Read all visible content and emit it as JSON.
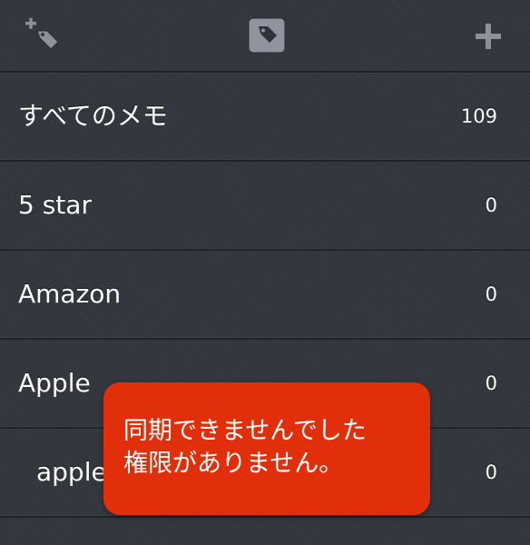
{
  "toolbar": {
    "left_icon": "add-tag-icon",
    "center_icon": "tag-icon",
    "right_icon": "plus-icon"
  },
  "tags": [
    {
      "label": "すべてのメモ",
      "count": "109"
    },
    {
      "label": "5 star",
      "count": "0"
    },
    {
      "label": "Amazon",
      "count": "0"
    },
    {
      "label": "Apple",
      "count": "0"
    },
    {
      "label": "apple",
      "count": "0"
    }
  ],
  "toast": {
    "line1": "同期できませんでした",
    "line2": "権限がありません。"
  },
  "colors": {
    "background": "#33363d",
    "toast": "#e12f0c",
    "text": "#ffffff"
  }
}
